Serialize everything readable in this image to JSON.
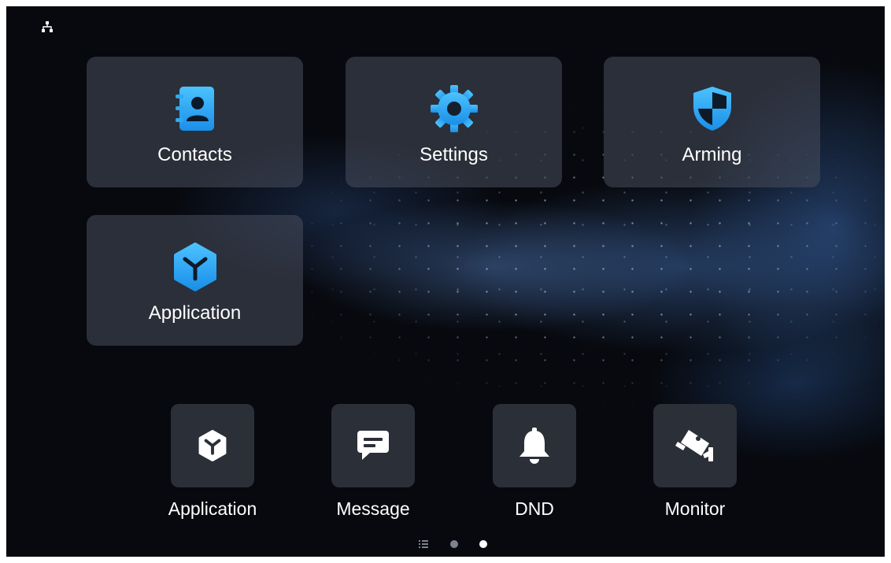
{
  "status_bar": {
    "network_icon": "network-topology-icon"
  },
  "tiles": [
    {
      "label": "Contacts",
      "icon": "contacts-book-icon",
      "color": "#2ea8f0"
    },
    {
      "label": "Settings",
      "icon": "gear-icon",
      "color": "#1e9cf0"
    },
    {
      "label": "Arming",
      "icon": "shield-icon",
      "color": "#2a9df2"
    },
    {
      "label": "Application",
      "icon": "cube-icon",
      "color": "#2aa6f2"
    }
  ],
  "dock": [
    {
      "label": "Application",
      "icon": "cube-icon"
    },
    {
      "label": "Message",
      "icon": "message-bubble-icon"
    },
    {
      "label": "DND",
      "icon": "bell-icon"
    },
    {
      "label": "Monitor",
      "icon": "camera-icon"
    }
  ],
  "pager": {
    "list_icon": "list-icon",
    "pages": 2,
    "current": 2
  },
  "colors": {
    "accent": "#2aa6f2",
    "tile_bg": "#484e5c",
    "dock_bg": "#2b2f38",
    "background": "#07090e"
  }
}
